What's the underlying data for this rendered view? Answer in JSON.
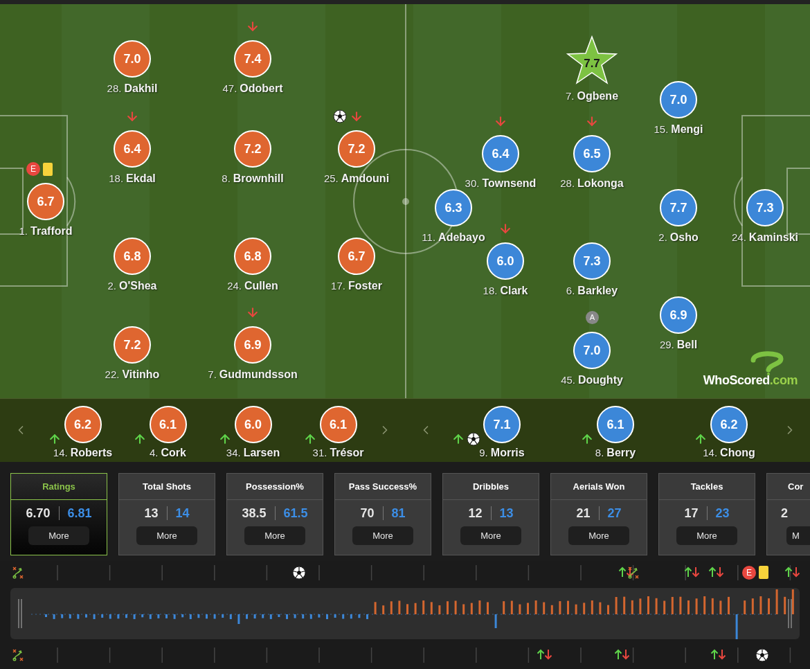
{
  "home_team": {
    "players": [
      {
        "number": "28.",
        "name": "Dakhil",
        "rating": "7.0",
        "best": false
      },
      {
        "number": "47.",
        "name": "Odobert",
        "rating": "7.4",
        "best": false,
        "events": [
          {
            "kind": "sub-off"
          }
        ]
      },
      {
        "number": "18.",
        "name": "Ekdal",
        "rating": "6.4",
        "best": false,
        "events": [
          {
            "kind": "sub-off"
          }
        ]
      },
      {
        "number": "8.",
        "name": "Brownhill",
        "rating": "7.2",
        "best": false
      },
      {
        "number": "25.",
        "name": "Amdouni",
        "rating": "7.2",
        "best": false,
        "events": [
          {
            "kind": "goal"
          },
          {
            "kind": "sub-off"
          }
        ]
      },
      {
        "number": "1.",
        "name": "Trafford",
        "rating": "6.7",
        "best": false,
        "events": [
          {
            "kind": "error",
            "label": "E"
          },
          {
            "kind": "yellow-card"
          }
        ]
      },
      {
        "number": "2.",
        "name": "O'Shea",
        "rating": "6.8",
        "best": false
      },
      {
        "number": "24.",
        "name": "Cullen",
        "rating": "6.8",
        "best": false
      },
      {
        "number": "17.",
        "name": "Foster",
        "rating": "6.7",
        "best": false
      },
      {
        "number": "22.",
        "name": "Vitinho",
        "rating": "7.2",
        "best": false
      },
      {
        "number": "7.",
        "name": "Gudmundsson",
        "rating": "6.9",
        "best": false,
        "events": [
          {
            "kind": "sub-off"
          }
        ]
      }
    ]
  },
  "away_team": {
    "players": [
      {
        "number": "7.",
        "name": "Ogbene",
        "rating": "7.7",
        "best": true
      },
      {
        "number": "15.",
        "name": "Mengi",
        "rating": "7.0",
        "best": false
      },
      {
        "number": "30.",
        "name": "Townsend",
        "rating": "6.4",
        "best": false,
        "events": [
          {
            "kind": "sub-off"
          }
        ]
      },
      {
        "number": "28.",
        "name": "Lokonga",
        "rating": "6.5",
        "best": false,
        "events": [
          {
            "kind": "sub-off"
          }
        ]
      },
      {
        "number": "11.",
        "name": "Adebayo",
        "rating": "6.3",
        "best": false
      },
      {
        "number": "2.",
        "name": "Osho",
        "rating": "7.7",
        "best": false
      },
      {
        "number": "24.",
        "name": "Kaminski",
        "rating": "7.3",
        "best": false
      },
      {
        "number": "18.",
        "name": "Clark",
        "rating": "6.0",
        "best": false,
        "events": [
          {
            "kind": "sub-off"
          }
        ]
      },
      {
        "number": "6.",
        "name": "Barkley",
        "rating": "7.3",
        "best": false
      },
      {
        "number": "45.",
        "name": "Doughty",
        "rating": "7.0",
        "best": false,
        "events": [
          {
            "kind": "captain",
            "label": "A"
          }
        ]
      },
      {
        "number": "29.",
        "name": "Bell",
        "rating": "6.9",
        "best": false
      }
    ]
  },
  "logo": {
    "text": "WhoScored",
    "suffix": ".com"
  },
  "bench": {
    "home": [
      {
        "number": "14.",
        "name": "Roberts",
        "rating": "6.2",
        "events": [
          {
            "kind": "sub-on"
          }
        ]
      },
      {
        "number": "4.",
        "name": "Cork",
        "rating": "6.1",
        "events": [
          {
            "kind": "sub-on"
          }
        ]
      },
      {
        "number": "34.",
        "name": "Larsen",
        "rating": "6.0",
        "events": [
          {
            "kind": "sub-on"
          }
        ]
      },
      {
        "number": "31.",
        "name": "Trésor",
        "rating": "6.1",
        "events": [
          {
            "kind": "sub-on"
          }
        ]
      }
    ],
    "away": [
      {
        "number": "9.",
        "name": "Morris",
        "rating": "7.1",
        "events": [
          {
            "kind": "sub-on"
          },
          {
            "kind": "goal"
          }
        ]
      },
      {
        "number": "8.",
        "name": "Berry",
        "rating": "6.1",
        "events": [
          {
            "kind": "sub-on"
          }
        ]
      },
      {
        "number": "14.",
        "name": "Chong",
        "rating": "6.2",
        "events": [
          {
            "kind": "sub-on"
          }
        ]
      }
    ]
  },
  "stats": [
    {
      "title": "Ratings",
      "home": "6.70",
      "away": "6.81",
      "button": "More",
      "selected": true
    },
    {
      "title": "Total Shots",
      "home": "13",
      "away": "14",
      "button": "More",
      "selected": false
    },
    {
      "title": "Possession%",
      "home": "38.5",
      "away": "61.5",
      "button": "More",
      "selected": false
    },
    {
      "title": "Pass Success%",
      "home": "70",
      "away": "81",
      "button": "More",
      "selected": false
    },
    {
      "title": "Dribbles",
      "home": "12",
      "away": "13",
      "button": "More",
      "selected": false
    },
    {
      "title": "Aerials Won",
      "home": "21",
      "away": "27",
      "button": "More",
      "selected": false
    },
    {
      "title": "Tackles",
      "home": "17",
      "away": "23",
      "button": "More",
      "selected": false
    },
    {
      "title": "Cor",
      "home": "2",
      "button": "M",
      "selected": false
    }
  ],
  "timeline": {
    "home_events": [
      {
        "kind": "tactics"
      },
      {
        "kind": "goal"
      },
      {
        "kind": "substitution"
      },
      {
        "kind": "tactics"
      },
      {
        "kind": "substitution"
      },
      {
        "kind": "substitution"
      },
      {
        "kind": "error",
        "label": "E"
      },
      {
        "kind": "yellow-card"
      },
      {
        "kind": "substitution"
      }
    ],
    "away_events": [
      {
        "kind": "tactics"
      },
      {
        "kind": "substitution"
      },
      {
        "kind": "substitution"
      },
      {
        "kind": "substitution"
      },
      {
        "kind": "goal"
      }
    ]
  }
}
